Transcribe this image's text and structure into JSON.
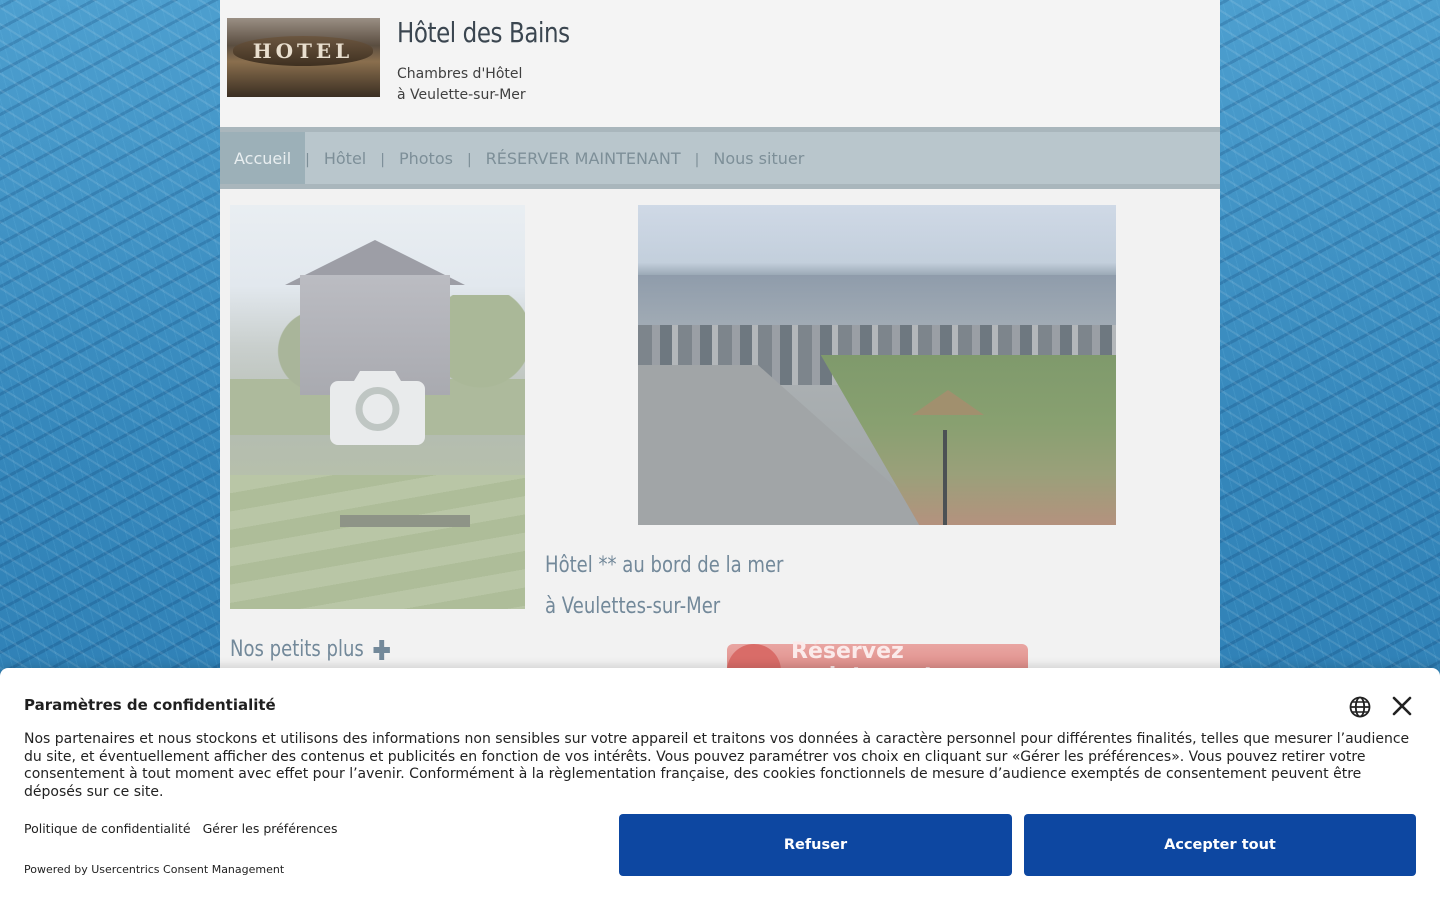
{
  "site": {
    "logo_text": "HOTEL",
    "title": "Hôtel des Bains",
    "subtitle_line1": "Chambres d'Hôtel",
    "subtitle_line2": "à Veulette-sur-Mer"
  },
  "nav": {
    "items": [
      {
        "label": "Accueil",
        "active": true
      },
      {
        "label": "Hôtel"
      },
      {
        "label": "Photos"
      },
      {
        "label": "RÉSERVER MAINTENANT"
      },
      {
        "label": "Nous situer"
      }
    ],
    "separator": "|"
  },
  "content": {
    "tagline_line1": "Hôtel ** au bord de la mer",
    "tagline_line2": "à Veulettes-sur-Mer",
    "nos_petits_plus": "Nos petits plus",
    "reserve_banner": "Réservez maintenant"
  },
  "consent": {
    "title": "Paramètres de confidentialité",
    "text": "Nos partenaires et nous stockons et utilisons des informations non sensibles sur votre appareil et traitons vos données à caractère personnel pour différentes finalités, telles que mesurer l’audience du site, et éventuellement afficher des contenus et publicités en fonction de vos intérêts. Vous pouvez paramétrer vos choix en cliquant sur «Gérer les préférences». Vous pouvez retirer votre consentement à tout moment avec effet pour l’avenir. Conformément à la règlementation française, des cookies fonctionnels de mesure d’audience exemptés de consentement peuvent être déposés sur ce site.",
    "link_privacy": "Politique de confidentialité",
    "link_preferences": "Gérer les préférences",
    "powered_by": "Powered by Usercentrics Consent Management",
    "refuse_label": "Refuser",
    "accept_label": "Accepter tout",
    "button_color": "#0d47a1"
  },
  "icons": {
    "language": "globe-icon",
    "close": "close-icon",
    "camera": "camera-icon",
    "plus": "plus-icon"
  }
}
